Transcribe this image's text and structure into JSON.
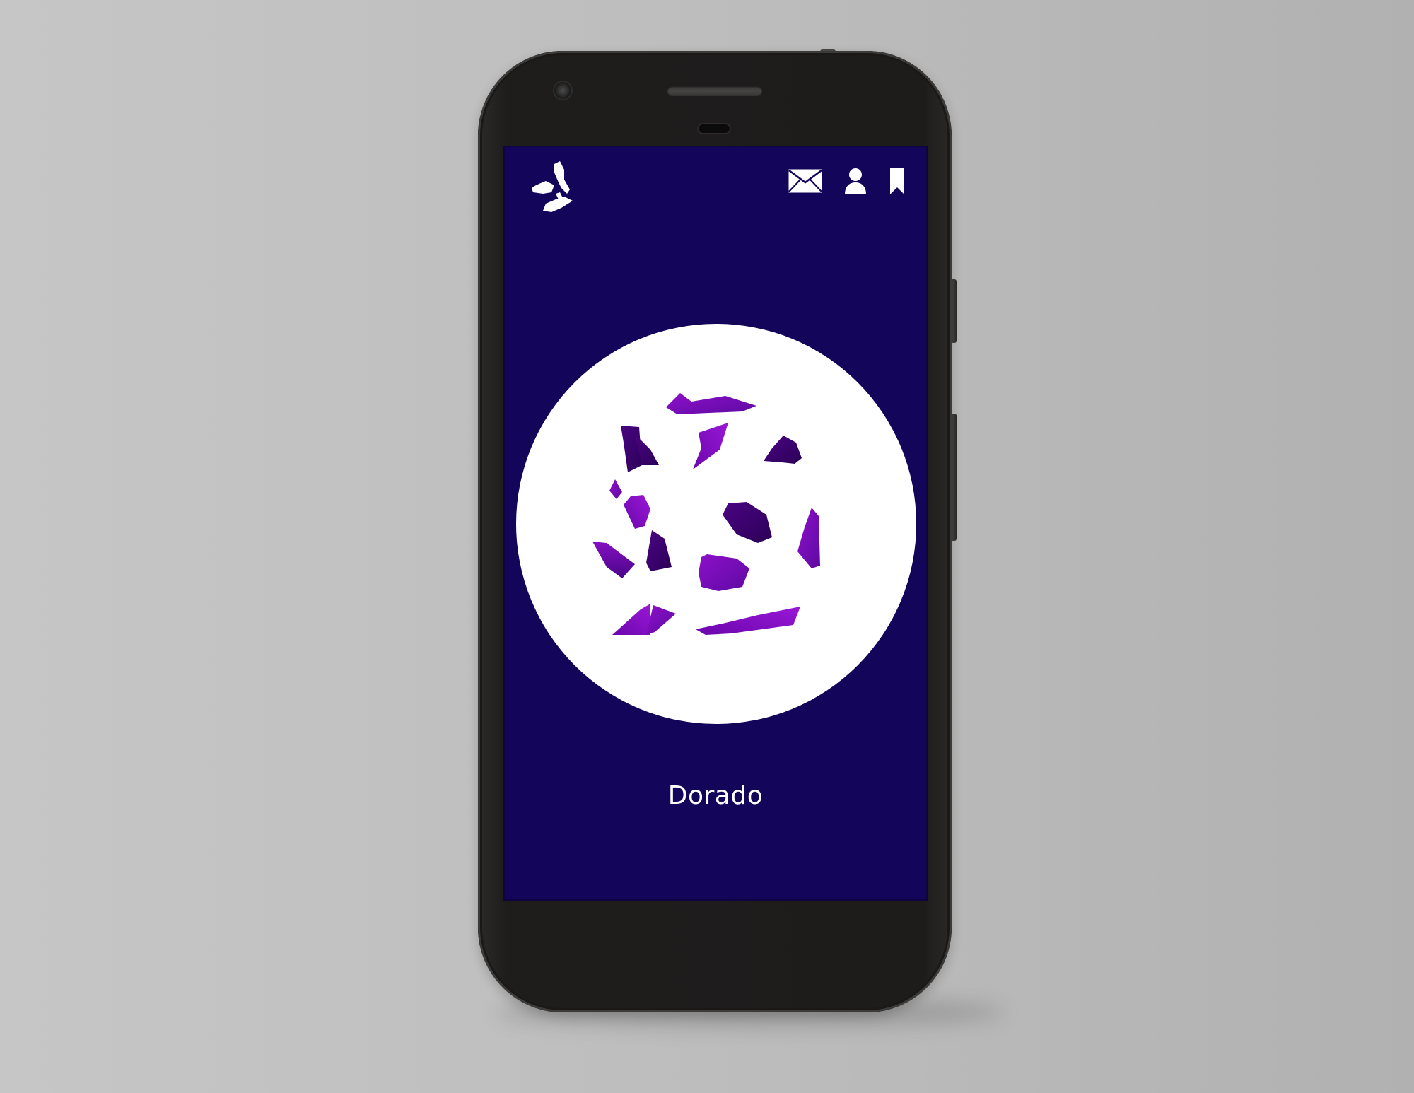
{
  "device": {
    "type": "android-phone-mockup",
    "frame_color": "#1e1d1c",
    "background_color": "#c0c0c0"
  },
  "app": {
    "background_color": "#13065a",
    "logo_icon": "shard-logo-icon",
    "actions": [
      {
        "icon": "mail-icon"
      },
      {
        "icon": "profile-icon"
      },
      {
        "icon": "bookmark-icon"
      }
    ]
  },
  "constellation": {
    "name": "Dorado",
    "disc_color": "#ffffff",
    "shard_colors": [
      "#7b05b8",
      "#5c0a99",
      "#3a0068",
      "#8d10c9"
    ]
  }
}
